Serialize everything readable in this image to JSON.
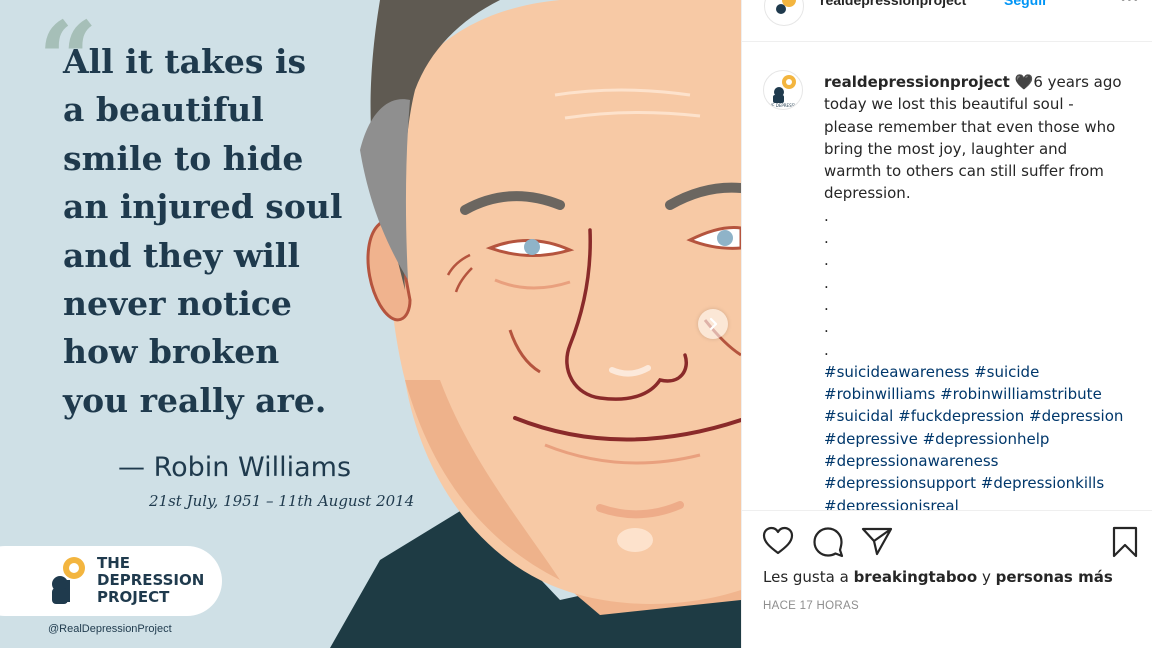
{
  "post_image": {
    "quote_lines": [
      "All it takes is",
      "a beautiful",
      "smile to hide",
      "an injured soul",
      "and they will",
      "never notice",
      "how broken",
      "you really are."
    ],
    "attribution": "— Robin Williams",
    "dates": "21st July, 1951 – 11th August 2014",
    "logo_lines": [
      "THE",
      "DEPRESSION",
      "PROJECT"
    ],
    "handle": "@RealDepressionProject",
    "next_icon": "chevron-right-icon"
  },
  "header": {
    "username": "realdepressionproject",
    "follow_label": "Seguir",
    "more_icon": "more-horizontal-icon"
  },
  "caption": {
    "username": "realdepressionproject",
    "emoji": "🖤",
    "lines": [
      "6 years ago",
      "today we lost this beautiful soul -",
      "please remember that even those who",
      "bring the most joy, laughter and",
      "warmth to others can still suffer from",
      "depression."
    ],
    "dots": [
      ".",
      ".",
      ".",
      ".",
      ".",
      ".",
      "."
    ],
    "hashtag_lines": [
      "#suicideawareness #suicide",
      "#robinwilliams #robinwilliamstribute",
      "#suicidal #fuckdepression #depression",
      "#depressive #depressionhelp",
      "#depressionawareness",
      "#depressionsupport #depressionkills",
      "#depressionisreal"
    ]
  },
  "actions": {
    "like_icon": "heart-icon",
    "comment_icon": "comment-icon",
    "share_icon": "send-icon",
    "save_icon": "bookmark-icon",
    "likes_prefix": "Les gusta a ",
    "likes_user": "breakingtaboo",
    "likes_mid": " y ",
    "likes_others": "personas más",
    "time": "HACE 17 HORAS"
  },
  "colors": {
    "link_blue": "#00376b",
    "follow_blue": "#0095f6",
    "quote_navy": "#1f3a4d",
    "image_bg": "#cfe0e6",
    "skin": "#f7c9a5"
  }
}
